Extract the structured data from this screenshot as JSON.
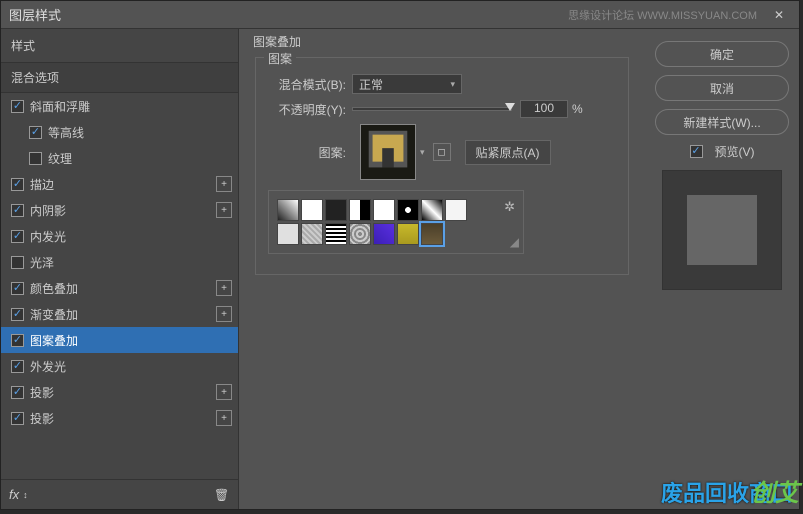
{
  "titlebar": {
    "title": "图层样式",
    "watermark": "思缘设计论坛  WWW.MISSYUAN.COM",
    "close": "✕"
  },
  "left": {
    "styles_header": "样式",
    "blend_header": "混合选项",
    "items": [
      {
        "label": "斜面和浮雕",
        "checked": true,
        "add": false,
        "indent": 0
      },
      {
        "label": "等高线",
        "checked": true,
        "add": false,
        "indent": 1
      },
      {
        "label": "纹理",
        "checked": false,
        "add": false,
        "indent": 1
      },
      {
        "label": "描边",
        "checked": true,
        "add": true,
        "indent": 0
      },
      {
        "label": "内阴影",
        "checked": true,
        "add": true,
        "indent": 0
      },
      {
        "label": "内发光",
        "checked": true,
        "add": false,
        "indent": 0
      },
      {
        "label": "光泽",
        "checked": false,
        "add": false,
        "indent": 0
      },
      {
        "label": "颜色叠加",
        "checked": true,
        "add": true,
        "indent": 0
      },
      {
        "label": "渐变叠加",
        "checked": true,
        "add": true,
        "indent": 0
      },
      {
        "label": "图案叠加",
        "checked": true,
        "add": false,
        "indent": 0,
        "selected": true
      },
      {
        "label": "外发光",
        "checked": true,
        "add": false,
        "indent": 0
      },
      {
        "label": "投影",
        "checked": true,
        "add": true,
        "indent": 0
      },
      {
        "label": "投影",
        "checked": true,
        "add": true,
        "indent": 0
      }
    ],
    "fx": "fx",
    "arrows": "↕",
    "trash": "🗑"
  },
  "center": {
    "outer_title": "图案叠加",
    "group_title": "图案",
    "blend_label": "混合模式(B):",
    "blend_value": "正常",
    "opacity_label": "不透明度(Y):",
    "opacity_value": "100",
    "opacity_unit": "%",
    "pattern_label": "图案:",
    "snap_btn": "贴紧原点(A)",
    "gear": "✲",
    "swatches": [
      "linear-gradient(45deg,#222,#fff)",
      "linear-gradient(#fff,#fff)",
      "linear-gradient(#222,#222)",
      "linear-gradient(90deg,#fff 50%,#000 50%)",
      "linear-gradient(#fff,#fff)",
      "radial-gradient(#fff 20%,#000 21%)",
      "linear-gradient(45deg,#000,#fff,#000)",
      "linear-gradient(#f4f4f4,#f4f4f4)",
      "linear-gradient(#e0e0e0,#e0e0e0)",
      "repeating-linear-gradient(45deg,#aaa,#aaa 2px,#ccc 2px,#ccc 4px)",
      "repeating-linear-gradient(#000,#000 2px,#fff 2px,#fff 4px)",
      "repeating-radial-gradient(#888,#888 2px,#ccc 2px,#ccc 4px)",
      "linear-gradient(45deg,#3b1fb5,#5a2fe0)",
      "linear-gradient(#c7b92b,#a99a1f)",
      "linear-gradient(#4a3f2a,#6b5a3a)"
    ],
    "selected_swatch": 14
  },
  "right": {
    "ok": "确定",
    "cancel": "取消",
    "new_style": "新建样式(W)...",
    "preview": "预览(V)"
  },
  "overlay": {
    "text": "废品回收商口",
    "badge": "创艾"
  }
}
